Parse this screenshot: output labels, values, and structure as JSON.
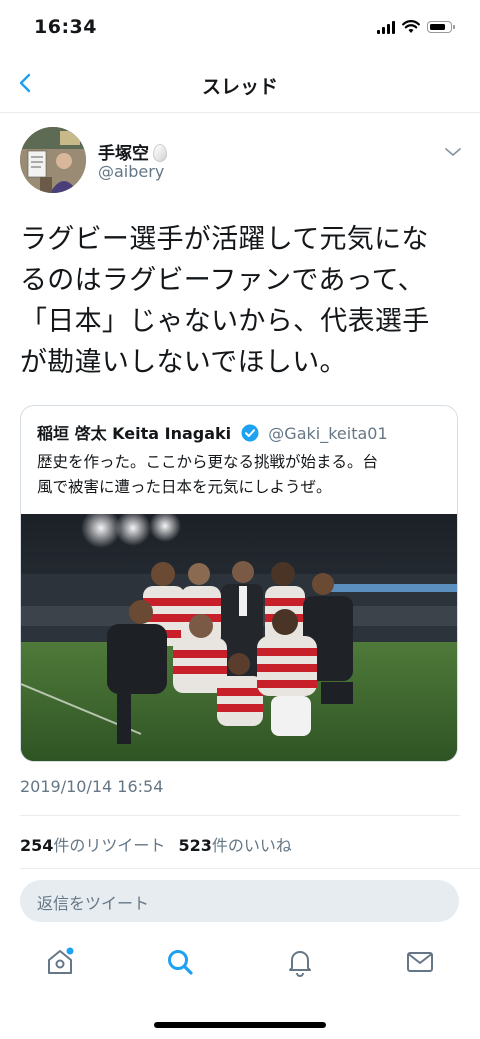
{
  "status_bar": {
    "time": "16:34"
  },
  "nav": {
    "title": "スレッド"
  },
  "tweet": {
    "author_name": "手塚空",
    "author_handle": "@aibery",
    "text": "ラグビー選手が活躍して元気にな\nるのはラグビーファンであって、\n「日本」じゃないから、代表選手\nが勘違いしないでほしい。",
    "timestamp": "2019/10/14 16:54",
    "retweets_count": "254",
    "retweets_label": "件のリツイート",
    "likes_count": "523",
    "likes_label": "件のいいね"
  },
  "quote": {
    "author_name": "稲垣 啓太 Keita Inagaki",
    "author_handle": "@Gaki_keita01",
    "text": "歴史を作った。ここから更なる挑戦が始まる。台\n風で被害に遭った日本を元気にしようぜ。"
  },
  "reply": {
    "placeholder": "返信をツイート"
  },
  "colors": {
    "accent": "#1da1f2",
    "secondary_text": "#657786",
    "divider": "#e6ecf0"
  },
  "tab_bar": {
    "icons": [
      "home-icon",
      "search-icon",
      "notifications-icon",
      "messages-icon"
    ],
    "active": "search-icon"
  }
}
